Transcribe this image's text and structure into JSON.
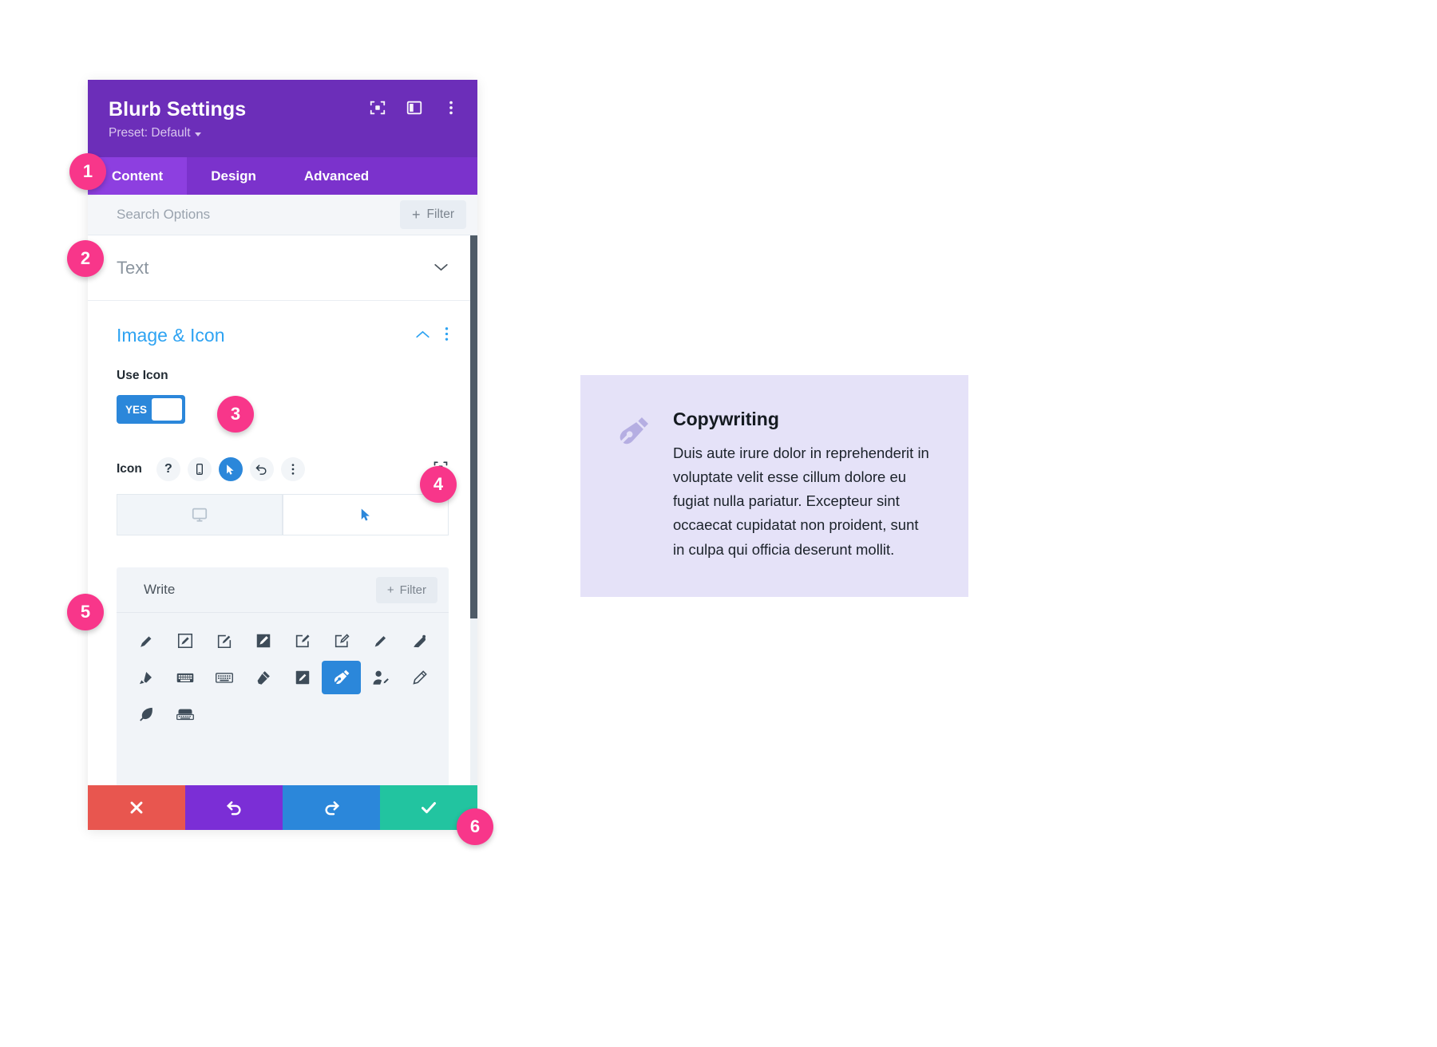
{
  "panel": {
    "title": "Blurb Settings",
    "preset": "Preset: Default",
    "header_icons": [
      "focus-frame-icon",
      "split-panel-icon",
      "vertical-dots-icon"
    ],
    "tabs": [
      {
        "label": "Content",
        "active": true
      },
      {
        "label": "Design",
        "active": false
      },
      {
        "label": "Advanced",
        "active": false
      }
    ],
    "search": {
      "placeholder": "Search Options",
      "filter_label": "Filter",
      "filter_plus": "+"
    },
    "collapsed_rows": [
      {
        "label": "Text"
      }
    ],
    "section": {
      "title": "Image & Icon",
      "use_icon_label": "Use Icon",
      "toggle_value": "YES",
      "icon_row_label": "Icon",
      "icon_controls": [
        {
          "name": "help-icon",
          "glyph": "?",
          "selected": false
        },
        {
          "name": "responsive-device-icon",
          "selected": false
        },
        {
          "name": "hover-cursor-icon",
          "selected": true
        },
        {
          "name": "reset-undo-icon",
          "selected": false
        },
        {
          "name": "vertical-dots-icon",
          "selected": false
        }
      ],
      "icon_row_right": "focus-frame-icon",
      "preview_tabs": [
        {
          "name": "desktop-preview-tab",
          "active": false
        },
        {
          "name": "hover-preview-tab",
          "active": true
        }
      ]
    },
    "picker": {
      "value": "Write",
      "filter_label": "Filter",
      "filter_plus": "+",
      "icons": [
        {
          "name": "pencil-diagonal-icon",
          "selected": false
        },
        {
          "name": "pencil-in-square-icon",
          "selected": false
        },
        {
          "name": "pencil-corner-icon",
          "selected": false
        },
        {
          "name": "pencil-square-filled-icon",
          "selected": false
        },
        {
          "name": "edit-square-pen-icon",
          "selected": false
        },
        {
          "name": "edit-square-outline-icon",
          "selected": false
        },
        {
          "name": "pencil-solid-icon",
          "selected": false
        },
        {
          "name": "quill-pen-icon",
          "selected": false
        },
        {
          "name": "marker-highlighter-icon",
          "selected": false
        },
        {
          "name": "keyboard-icon",
          "selected": false
        },
        {
          "name": "keyboard-alt-icon",
          "selected": false
        },
        {
          "name": "pen-tilted-icon",
          "selected": false
        },
        {
          "name": "edit-box-filled-icon",
          "selected": false
        },
        {
          "name": "fountain-pen-nib-icon",
          "selected": true
        },
        {
          "name": "user-edit-icon",
          "selected": false
        },
        {
          "name": "pen-thin-icon",
          "selected": false
        },
        {
          "name": "feather-icon",
          "selected": false
        },
        {
          "name": "typewriter-icon",
          "selected": false
        }
      ]
    },
    "actions": [
      {
        "name": "cancel-button",
        "icon": "close-x-icon",
        "color": "#E8564F"
      },
      {
        "name": "undo-button",
        "icon": "undo-arrow-icon",
        "color": "#7B2ED6"
      },
      {
        "name": "redo-button",
        "icon": "redo-arrow-icon",
        "color": "#2B87DA"
      },
      {
        "name": "save-button",
        "icon": "check-icon",
        "color": "#22C4A0"
      }
    ]
  },
  "badges": [
    {
      "label": "1"
    },
    {
      "label": "2"
    },
    {
      "label": "3"
    },
    {
      "label": "4"
    },
    {
      "label": "5"
    },
    {
      "label": "6"
    }
  ],
  "blurb": {
    "icon_name": "fountain-pen-nib-icon",
    "title": "Copywriting",
    "body": "Duis aute irure dolor in reprehenderit in voluptate velit esse cillum dolore eu fugiat nulla pariatur. Excepteur sint occaecat cupidatat non proident, sunt in culpa qui officia deserunt mollit."
  },
  "colors": {
    "header_purple": "#6C2EB9",
    "tab_bar_purple": "#7B32CC",
    "tab_active_purple": "#8D3FE0",
    "accent_blue": "#2B87DA",
    "section_title_blue": "#2EA3F2",
    "badge_pink": "#F8368A",
    "card_lavender": "#E5E2F8"
  }
}
